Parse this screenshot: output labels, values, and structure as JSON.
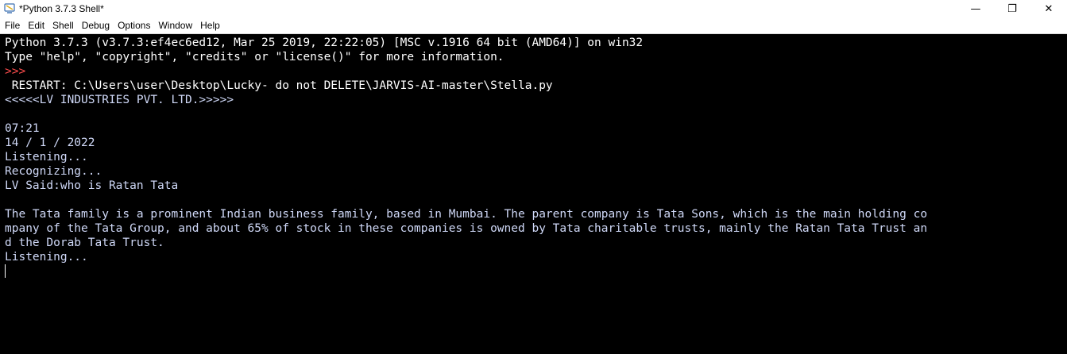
{
  "window": {
    "title": "*Python 3.7.3 Shell*",
    "icon": "python-idle-icon",
    "controls": {
      "minimize": "—",
      "restore": "❐",
      "close": "✕"
    }
  },
  "menubar": {
    "items": [
      "File",
      "Edit",
      "Shell",
      "Debug",
      "Options",
      "Window",
      "Help"
    ]
  },
  "shell": {
    "banner1": "Python 3.7.3 (v3.7.3:ef4ec6ed12, Mar 25 2019, 22:22:05) [MSC v.1916 64 bit (AMD64)] on win32",
    "banner2": "Type \"help\", \"copyright\", \"credits\" or \"license()\" for more information.",
    "prompt": ">>>",
    "restart": " RESTART: C:\\Users\\user\\Desktop\\Lucky- do not DELETE\\JARVIS-AI-master\\Stella.py",
    "out1": "<<<<<LV INDUSTRIES PVT. LTD.>>>>>",
    "out2": "",
    "out3": "07:21",
    "out4": "14 / 1 / 2022",
    "out5": "Listening...",
    "out6": "Recognizing...",
    "out7": "LV Said:who is Ratan Tata",
    "out8": "",
    "out9": "The Tata family is a prominent Indian business family, based in Mumbai. The parent company is Tata Sons, which is the main holding co",
    "out10": "mpany of the Tata Group, and about 65% of stock in these companies is owned by Tata charitable trusts, mainly the Ratan Tata Trust an",
    "out11": "d the Dorab Tata Trust.",
    "out12": "Listening..."
  },
  "colors": {
    "background": "#000000",
    "prompt": "#ff4d4d",
    "output": "#cfd8f7",
    "text": "#ffffff"
  }
}
